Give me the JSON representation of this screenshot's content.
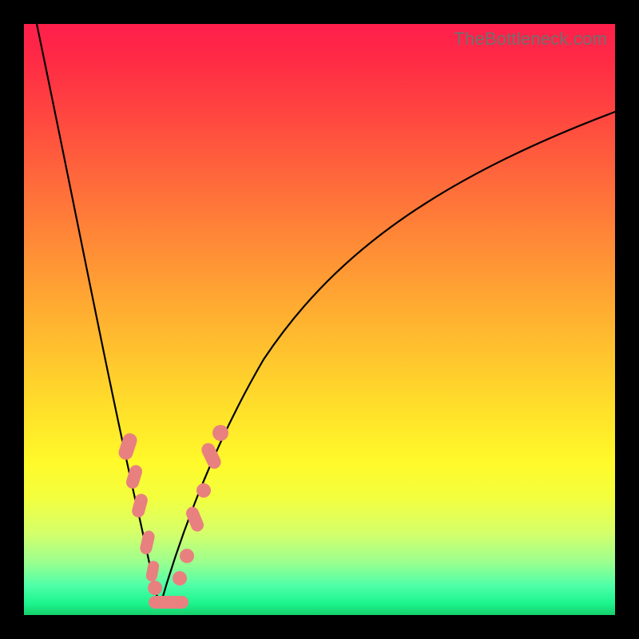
{
  "watermark": "TheBottleneck.com",
  "colors": {
    "background_frame": "#000000",
    "gradient_top": "#ff1f4b",
    "gradient_bottom": "#17d06a",
    "curve_stroke": "#000000",
    "marker_fill": "#e98080"
  },
  "chart_data": {
    "type": "line",
    "title": "",
    "xlabel": "",
    "ylabel": "",
    "xlim": [
      0,
      100
    ],
    "ylim": [
      0,
      100
    ],
    "note": "Bottleneck-style V-curve. y is percent bottleneck (0 at minimum). x is a normalized component-ratio axis. Minimum occurs near x≈22. No numeric axis ticks are shown in the source image; values below are geometric estimates from the plotted curve.",
    "series": [
      {
        "name": "bottleneck-curve",
        "x": [
          0,
          4,
          8,
          12,
          15,
          18,
          20,
          22,
          24,
          26,
          30,
          36,
          44,
          54,
          66,
          80,
          92,
          100
        ],
        "y": [
          100,
          80,
          62,
          46,
          33,
          20,
          10,
          0,
          8,
          15,
          28,
          42,
          55,
          66,
          75,
          81,
          84,
          86
        ]
      }
    ],
    "markers": {
      "name": "highlighted-points",
      "description": "Pink lozenge markers clustered near the curve minimum on both branches.",
      "points": [
        {
          "x": 15.5,
          "y": 30,
          "shape": "lozenge"
        },
        {
          "x": 16.8,
          "y": 24,
          "shape": "lozenge"
        },
        {
          "x": 17.8,
          "y": 19,
          "shape": "lozenge"
        },
        {
          "x": 19.2,
          "y": 12,
          "shape": "lozenge"
        },
        {
          "x": 20.0,
          "y": 7,
          "shape": "lozenge"
        },
        {
          "x": 21.0,
          "y": 3,
          "shape": "dot"
        },
        {
          "x": 22.0,
          "y": 1.5,
          "shape": "bar"
        },
        {
          "x": 24.0,
          "y": 2,
          "shape": "bar"
        },
        {
          "x": 25.5,
          "y": 6,
          "shape": "dot"
        },
        {
          "x": 26.5,
          "y": 10,
          "shape": "dot"
        },
        {
          "x": 28.0,
          "y": 17,
          "shape": "lozenge"
        },
        {
          "x": 29.0,
          "y": 21,
          "shape": "dot"
        },
        {
          "x": 30.5,
          "y": 27,
          "shape": "lozenge"
        },
        {
          "x": 31.5,
          "y": 30,
          "shape": "dot"
        }
      ]
    }
  }
}
